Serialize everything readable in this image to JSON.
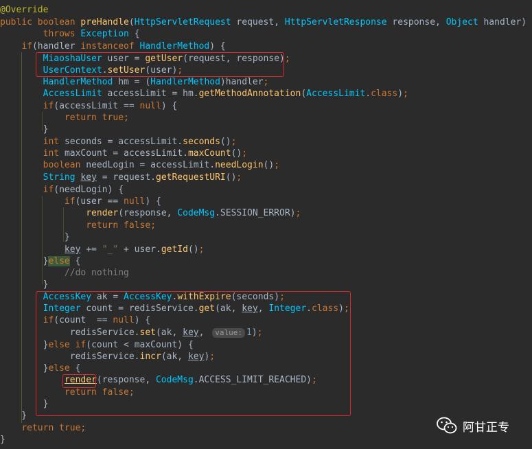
{
  "code_lines": [
    [
      {
        "t": "@Override",
        "c": "ann"
      }
    ],
    [
      {
        "t": "public ",
        "c": "kw"
      },
      {
        "t": "boolean ",
        "c": "kw"
      },
      {
        "t": "preHandle",
        "c": "fn"
      },
      {
        "t": "(",
        "c": "pl"
      },
      {
        "t": "HttpServletRequest",
        "c": "ty"
      },
      {
        "t": " request, ",
        "c": "pl"
      },
      {
        "t": "HttpServletResponse",
        "c": "ty"
      },
      {
        "t": " response, ",
        "c": "pl"
      },
      {
        "t": "Object",
        "c": "ty"
      },
      {
        "t": " handler)",
        "c": "pl"
      }
    ],
    [
      {
        "t": "        ",
        "c": "pl"
      },
      {
        "t": "throws ",
        "c": "kw"
      },
      {
        "t": "Exception",
        "c": "ty"
      },
      {
        "t": " {",
        "c": "pl"
      }
    ],
    [
      {
        "t": "    ",
        "c": "pl"
      },
      {
        "t": "if",
        "c": "kw"
      },
      {
        "t": "(handler ",
        "c": "pl"
      },
      {
        "t": "instanceof ",
        "c": "kw"
      },
      {
        "t": "HandlerMethod",
        "c": "ty"
      },
      {
        "t": ") {",
        "c": "pl"
      }
    ],
    [
      {
        "t": "        ",
        "c": "pl"
      },
      {
        "t": "MiaoshaUser",
        "c": "ty"
      },
      {
        "t": " user = ",
        "c": "pl"
      },
      {
        "t": "getUser",
        "c": "fn"
      },
      {
        "t": "(request, response)",
        "c": "pl"
      },
      {
        "t": ";",
        "c": "kw"
      }
    ],
    [
      {
        "t": "        ",
        "c": "pl"
      },
      {
        "t": "UserContext",
        "c": "ty"
      },
      {
        "t": ".",
        "c": "pl"
      },
      {
        "t": "setUser",
        "c": "fn"
      },
      {
        "t": "(user)",
        "c": "pl"
      },
      {
        "t": ";",
        "c": "kw"
      }
    ],
    [
      {
        "t": "        ",
        "c": "pl"
      },
      {
        "t": "HandlerMethod",
        "c": "ty"
      },
      {
        "t": " hm = (",
        "c": "pl"
      },
      {
        "t": "HandlerMethod",
        "c": "ty"
      },
      {
        "t": ")handler",
        "c": "pl"
      },
      {
        "t": ";",
        "c": "kw"
      }
    ],
    [
      {
        "t": "        ",
        "c": "pl"
      },
      {
        "t": "AccessLimit",
        "c": "ty"
      },
      {
        "t": " accessLimit = hm.",
        "c": "pl"
      },
      {
        "t": "getMethodAnnotation",
        "c": "fn"
      },
      {
        "t": "(",
        "c": "pl"
      },
      {
        "t": "AccessLimit",
        "c": "ty"
      },
      {
        "t": ".",
        "c": "pl"
      },
      {
        "t": "class",
        "c": "kw"
      },
      {
        "t": ")",
        "c": "pl"
      },
      {
        "t": ";",
        "c": "kw"
      }
    ],
    [
      {
        "t": "        ",
        "c": "pl"
      },
      {
        "t": "if",
        "c": "kw"
      },
      {
        "t": "(accessLimit == ",
        "c": "pl"
      },
      {
        "t": "null",
        "c": "kw"
      },
      {
        "t": ") {",
        "c": "pl"
      }
    ],
    [
      {
        "t": "            ",
        "c": "pl"
      },
      {
        "t": "return ",
        "c": "kw"
      },
      {
        "t": "true",
        "c": "kw"
      },
      {
        "t": ";",
        "c": "kw"
      }
    ],
    [
      {
        "t": "        }",
        "c": "pl"
      }
    ],
    [
      {
        "t": "        ",
        "c": "pl"
      },
      {
        "t": "int ",
        "c": "kw"
      },
      {
        "t": "seconds = accessLimit.",
        "c": "pl"
      },
      {
        "t": "seconds",
        "c": "fn"
      },
      {
        "t": "()",
        "c": "pl"
      },
      {
        "t": ";",
        "c": "kw"
      }
    ],
    [
      {
        "t": "        ",
        "c": "pl"
      },
      {
        "t": "int ",
        "c": "kw"
      },
      {
        "t": "maxCount = accessLimit.",
        "c": "pl"
      },
      {
        "t": "maxCount",
        "c": "fn"
      },
      {
        "t": "()",
        "c": "pl"
      },
      {
        "t": ";",
        "c": "kw"
      }
    ],
    [
      {
        "t": "        ",
        "c": "pl"
      },
      {
        "t": "boolean ",
        "c": "kw"
      },
      {
        "t": "needLogin = accessLimit.",
        "c": "pl"
      },
      {
        "t": "needLogin",
        "c": "fn"
      },
      {
        "t": "()",
        "c": "pl"
      },
      {
        "t": ";",
        "c": "kw"
      }
    ],
    [
      {
        "t": "        ",
        "c": "pl"
      },
      {
        "t": "String ",
        "c": "ty"
      },
      {
        "t": "key",
        "c": "pl ul"
      },
      {
        "t": " = request.",
        "c": "pl"
      },
      {
        "t": "getRequestURI",
        "c": "fn"
      },
      {
        "t": "()",
        "c": "pl"
      },
      {
        "t": ";",
        "c": "kw"
      }
    ],
    [
      {
        "t": "        ",
        "c": "pl"
      },
      {
        "t": "if",
        "c": "kw"
      },
      {
        "t": "(needLogin) {",
        "c": "pl"
      }
    ],
    [
      {
        "t": "            ",
        "c": "pl"
      },
      {
        "t": "if",
        "c": "kw"
      },
      {
        "t": "(user == ",
        "c": "pl"
      },
      {
        "t": "null",
        "c": "kw"
      },
      {
        "t": ") {",
        "c": "pl"
      }
    ],
    [
      {
        "t": "                ",
        "c": "pl"
      },
      {
        "t": "render",
        "c": "fn"
      },
      {
        "t": "(response, ",
        "c": "pl"
      },
      {
        "t": "CodeMsg",
        "c": "ty"
      },
      {
        "t": ".SESSION_ERROR)",
        "c": "pl"
      },
      {
        "t": ";",
        "c": "kw"
      }
    ],
    [
      {
        "t": "                ",
        "c": "pl"
      },
      {
        "t": "return ",
        "c": "kw"
      },
      {
        "t": "false",
        "c": "kw"
      },
      {
        "t": ";",
        "c": "kw"
      }
    ],
    [
      {
        "t": "            }",
        "c": "pl"
      }
    ],
    [
      {
        "t": "            ",
        "c": "pl"
      },
      {
        "t": "key",
        "c": "pl ul"
      },
      {
        "t": " += ",
        "c": "pl"
      },
      {
        "t": "\"_\"",
        "c": "st"
      },
      {
        "t": " + user.",
        "c": "pl"
      },
      {
        "t": "getId",
        "c": "fn"
      },
      {
        "t": "()",
        "c": "pl"
      },
      {
        "t": ";",
        "c": "kw"
      }
    ],
    [
      {
        "t": "        }",
        "c": "pl"
      },
      {
        "t": "else",
        "c": "kw hl-else"
      },
      {
        "t": " {",
        "c": "pl"
      }
    ],
    [
      {
        "t": "            ",
        "c": "pl"
      },
      {
        "t": "//do nothing",
        "c": "cm"
      }
    ],
    [
      {
        "t": "        }",
        "c": "pl"
      }
    ],
    [
      {
        "t": "        ",
        "c": "pl"
      },
      {
        "t": "AccessKey",
        "c": "ty"
      },
      {
        "t": " ak = ",
        "c": "pl"
      },
      {
        "t": "AccessKey",
        "c": "ty"
      },
      {
        "t": ".",
        "c": "pl"
      },
      {
        "t": "withExpire",
        "c": "fn"
      },
      {
        "t": "(seconds)",
        "c": "pl"
      },
      {
        "t": ";",
        "c": "kw"
      }
    ],
    [
      {
        "t": "        ",
        "c": "pl"
      },
      {
        "t": "Integer",
        "c": "ty"
      },
      {
        "t": " count = redisService.",
        "c": "pl"
      },
      {
        "t": "get",
        "c": "fn"
      },
      {
        "t": "(ak, ",
        "c": "pl"
      },
      {
        "t": "key",
        "c": "pl ul"
      },
      {
        "t": ", ",
        "c": "pl"
      },
      {
        "t": "Integer",
        "c": "ty"
      },
      {
        "t": ".",
        "c": "pl"
      },
      {
        "t": "class",
        "c": "kw"
      },
      {
        "t": ")",
        "c": "pl"
      },
      {
        "t": ";",
        "c": "kw"
      }
    ],
    [
      {
        "t": "        ",
        "c": "pl"
      },
      {
        "t": "if",
        "c": "kw"
      },
      {
        "t": "(count  == ",
        "c": "pl"
      },
      {
        "t": "null",
        "c": "kw"
      },
      {
        "t": ") {",
        "c": "pl"
      }
    ],
    [
      {
        "t": "             redisService.",
        "c": "pl"
      },
      {
        "t": "set",
        "c": "fn"
      },
      {
        "t": "(ak, ",
        "c": "pl"
      },
      {
        "t": "key",
        "c": "pl ul"
      },
      {
        "t": ", ",
        "c": "pl"
      },
      {
        "t": "value:",
        "c": "hint"
      },
      {
        "t": "1",
        "c": "nm"
      },
      {
        "t": ")",
        "c": "pl"
      },
      {
        "t": ";",
        "c": "kw"
      }
    ],
    [
      {
        "t": "        }",
        "c": "pl"
      },
      {
        "t": "else ",
        "c": "kw"
      },
      {
        "t": "if",
        "c": "kw"
      },
      {
        "t": "(count < maxCount) {",
        "c": "pl"
      }
    ],
    [
      {
        "t": "             redisService.",
        "c": "pl"
      },
      {
        "t": "incr",
        "c": "fn"
      },
      {
        "t": "(ak, ",
        "c": "pl"
      },
      {
        "t": "key",
        "c": "pl ul"
      },
      {
        "t": ")",
        "c": "pl"
      },
      {
        "t": ";",
        "c": "kw"
      }
    ],
    [
      {
        "t": "        }",
        "c": "pl"
      },
      {
        "t": "else",
        "c": "kw"
      },
      {
        "t": " {",
        "c": "pl"
      }
    ],
    [
      {
        "t": "            ",
        "c": "pl"
      },
      {
        "t": "render",
        "c": "fn ul"
      },
      {
        "t": "(response, ",
        "c": "pl"
      },
      {
        "t": "CodeMsg",
        "c": "ty"
      },
      {
        "t": ".ACCESS_LIMIT_REACHED)",
        "c": "pl"
      },
      {
        "t": ";",
        "c": "kw"
      }
    ],
    [
      {
        "t": "            ",
        "c": "pl"
      },
      {
        "t": "return ",
        "c": "kw"
      },
      {
        "t": "false",
        "c": "kw"
      },
      {
        "t": ";",
        "c": "kw"
      }
    ],
    [
      {
        "t": "        }",
        "c": "pl"
      }
    ],
    [
      {
        "t": "    }",
        "c": "pl"
      }
    ],
    [
      {
        "t": "    ",
        "c": "pl"
      },
      {
        "t": "return ",
        "c": "kw"
      },
      {
        "t": "true",
        "c": "kw"
      },
      {
        "t": ";",
        "c": "kw"
      }
    ],
    [
      {
        "t": "}",
        "c": "pl"
      }
    ]
  ],
  "watermark": {
    "icon": "wechat-icon",
    "text": "阿甘正专"
  },
  "highlight_color": "#e0262b"
}
